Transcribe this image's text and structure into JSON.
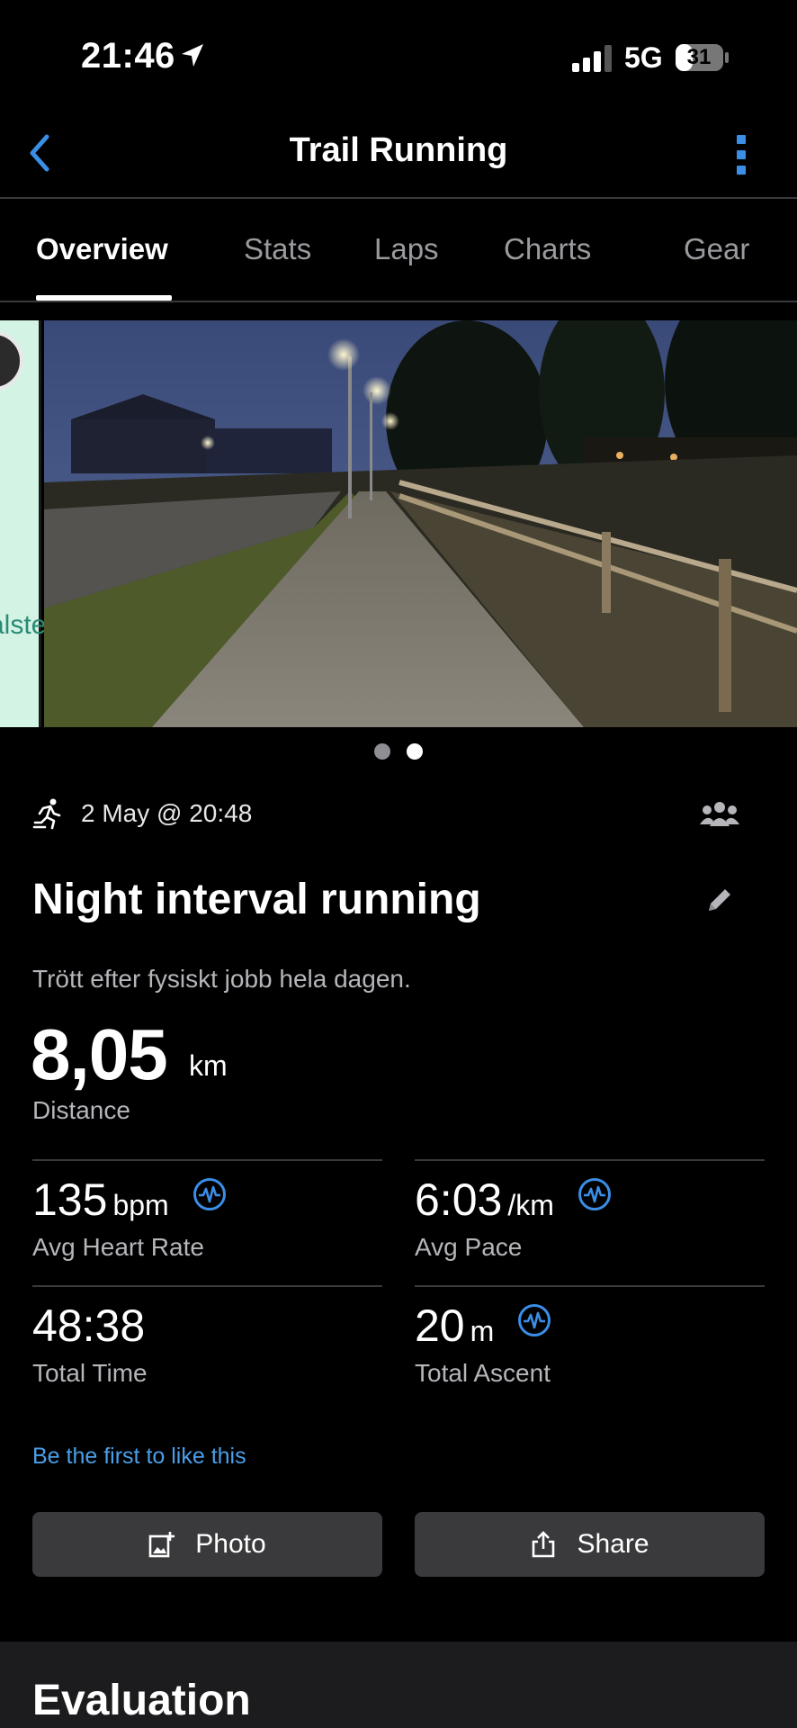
{
  "status_bar": {
    "time": "21:46",
    "network": "5G",
    "battery": "31",
    "icons": [
      "location-arrow-icon",
      "signal-bars-icon",
      "battery-icon"
    ]
  },
  "header": {
    "title": "Trail Running",
    "back_icon": "chevron-left-icon",
    "more_icon": "vertical-dots-icon",
    "accent_color": "#3a8ee6"
  },
  "tabs": [
    {
      "label": "Overview",
      "active": true
    },
    {
      "label": "Stats",
      "active": false
    },
    {
      "label": "Laps",
      "active": false
    },
    {
      "label": "Charts",
      "active": false
    },
    {
      "label": "Gear",
      "active": false
    }
  ],
  "carousel": {
    "map_partial_label": "alste",
    "page_count": 2,
    "active_page": 2
  },
  "activity": {
    "type_icon": "running-person-icon",
    "date": "2 May @ 20:48",
    "privacy_icon": "group-icon",
    "title": "Night interval running",
    "description": "Trött efter fysiskt jobb hela dagen.",
    "distance": {
      "value": "8,05",
      "unit": "km",
      "label": "Distance"
    }
  },
  "stats": [
    {
      "value": "135",
      "unit": "bpm",
      "label": "Avg Heart Rate",
      "badge": true
    },
    {
      "value": "6:03",
      "unit": "/km",
      "label": "Avg Pace",
      "badge": true
    },
    {
      "value": "48:38",
      "unit": "",
      "label": "Total Time",
      "badge": false
    },
    {
      "value": "20",
      "unit": "m",
      "label": "Total Ascent",
      "badge": true
    }
  ],
  "social": {
    "like_text": "Be the first to like this",
    "link_color": "#4a9fe8"
  },
  "buttons": {
    "photo_label": "Photo",
    "share_label": "Share"
  },
  "evaluation": {
    "title": "Evaluation"
  }
}
